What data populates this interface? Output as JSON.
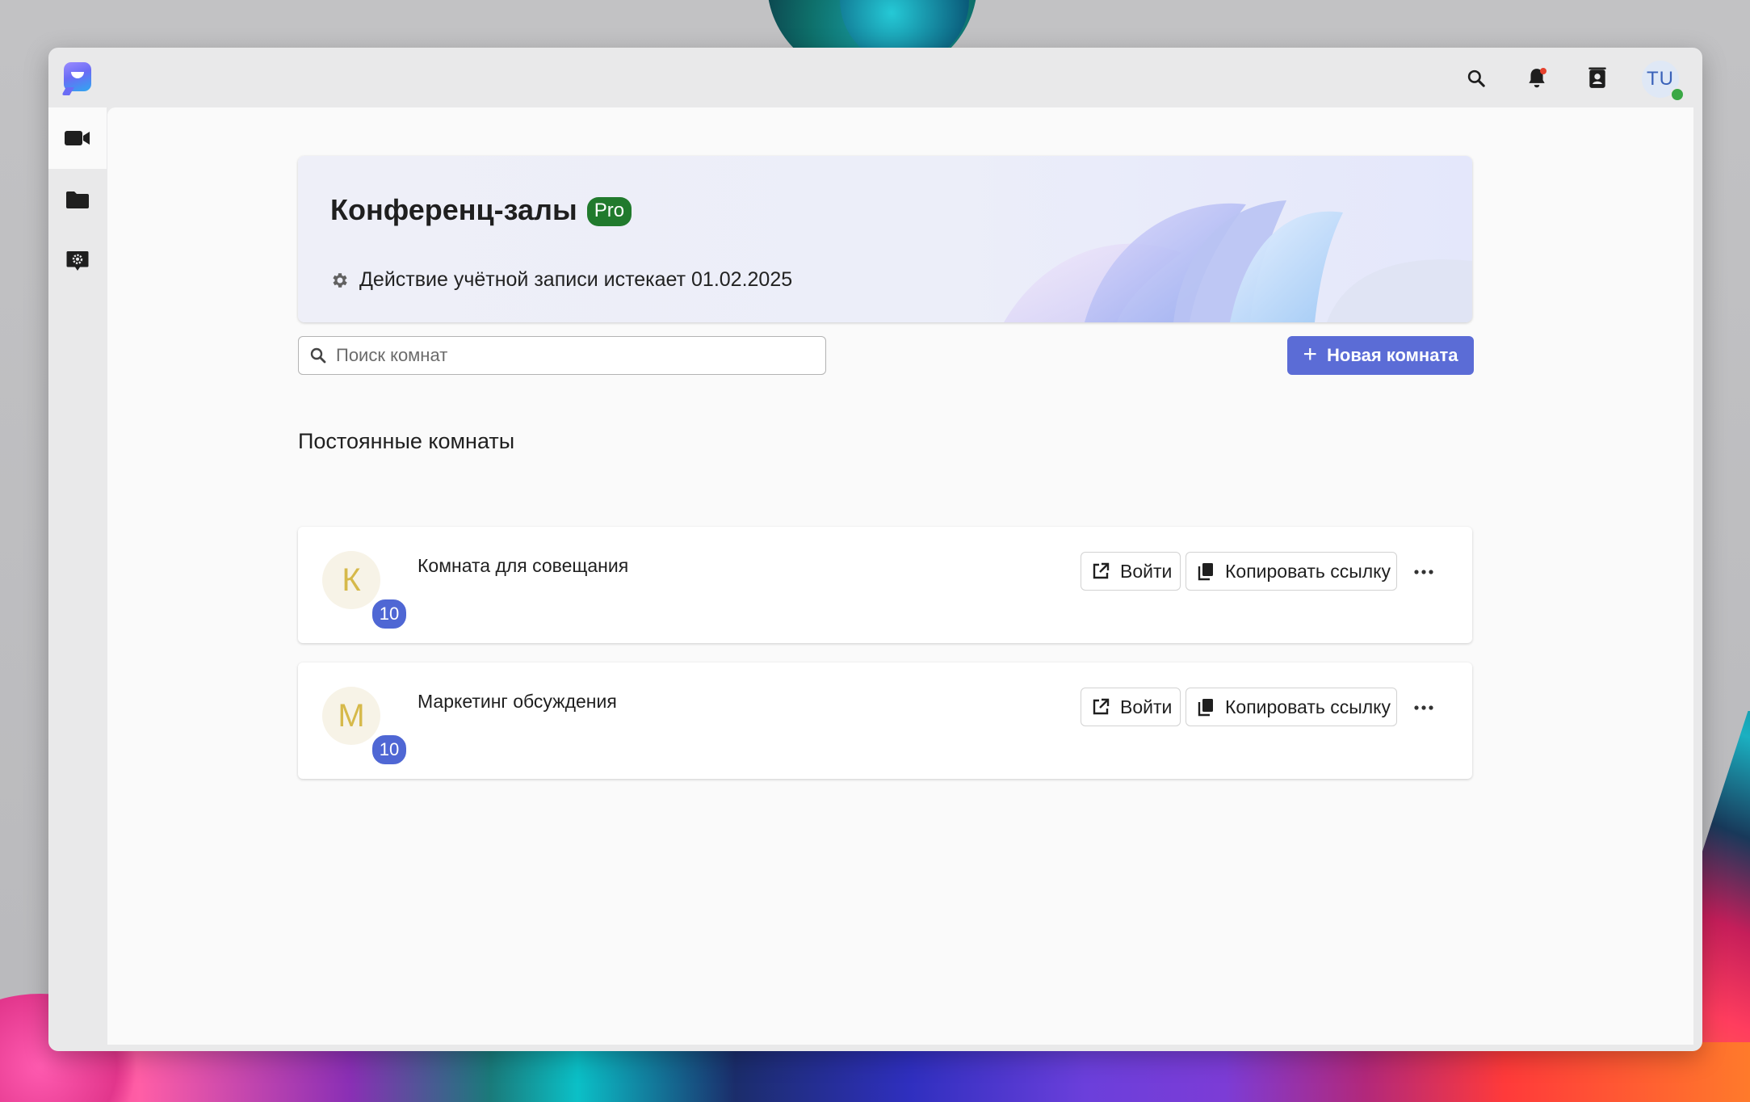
{
  "header": {
    "search_icon": "search-icon",
    "notifications_icon": "bell-icon",
    "contacts_icon": "contacts-icon",
    "user_initials": "TU",
    "user_status": "online"
  },
  "sidebar": {
    "items": [
      {
        "icon": "video-camera-icon",
        "active": true
      },
      {
        "icon": "folder-icon",
        "active": false
      },
      {
        "icon": "settings-chat-icon",
        "active": false
      }
    ]
  },
  "banner": {
    "title": "Конференц-залы",
    "badge": "Pro",
    "expiry_text": "Действие учётной записи истекает 01.02.2025"
  },
  "search": {
    "placeholder": "Поиск комнат",
    "value": ""
  },
  "new_room_button": {
    "label": "Новая комната"
  },
  "rooms_section": {
    "title": "Постоянные комнаты",
    "rooms": [
      {
        "initial": "К",
        "name": "Комната для совещания",
        "participants": "10",
        "enter_label": "Войти",
        "copy_label": "Копировать ссылку"
      },
      {
        "initial": "М",
        "name": "Маркетинг обсуждения",
        "participants": "10",
        "enter_label": "Войти",
        "copy_label": "Копировать ссылку"
      }
    ]
  },
  "colors": {
    "accent": "#5b6cd6",
    "pro_badge": "#217a2d",
    "count_badge": "#4f67d4",
    "avatar_letter": "#d6b94a"
  }
}
